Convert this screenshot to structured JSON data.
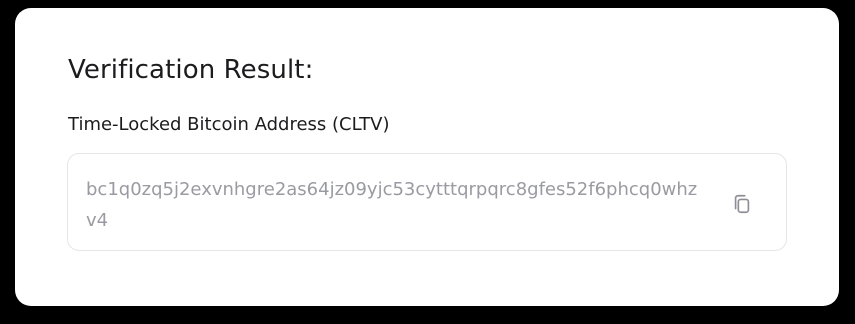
{
  "card": {
    "title": "Verification Result:",
    "address_label": "Time-Locked Bitcoin Address (CLTV)",
    "address_value": "bc1q0zq5j2exvnhgre2as64jz09yjc53cytttqrpqrc8gfes52f6phcq0whzv4",
    "copy_icon": "copy-icon"
  },
  "colors": {
    "background": "#000000",
    "card": "#ffffff",
    "text": "#1c1c1e",
    "muted": "#9a9aa2",
    "border": "#e6e6e9"
  }
}
